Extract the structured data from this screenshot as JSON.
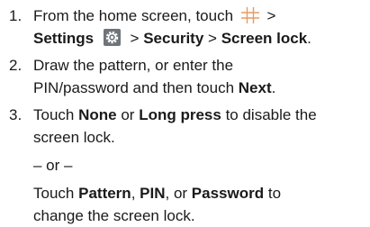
{
  "steps": [
    {
      "number": "1.",
      "line1_pre": "From the home screen, touch",
      "line1_post": ">",
      "settings": "Settings",
      "sep1": ">",
      "security": "Security",
      "sep2": ">",
      "screen_lock": "Screen lock",
      "end": "."
    },
    {
      "number": "2.",
      "line1": "Draw the pattern, or enter the",
      "line2_pre": "PIN/password and then touch",
      "next": "Next",
      "end": "."
    },
    {
      "number": "3.",
      "touch": "Touch",
      "none": "None",
      "or": "or",
      "long_press": "Long press",
      "line1_post": "to disable the",
      "line2": "screen lock.",
      "or_divider": "– or –",
      "touch2": "Touch",
      "pattern": "Pattern",
      "comma1": ",",
      "pin": "PIN",
      "or2": ", or",
      "password": "Password",
      "to": "to",
      "line_last": "change the screen lock."
    }
  ],
  "icons": {
    "apps": "apps-grid-icon",
    "settings": "settings-gear-icon",
    "apps_color": "#e07a2a",
    "settings_bg": "#6e7479"
  }
}
